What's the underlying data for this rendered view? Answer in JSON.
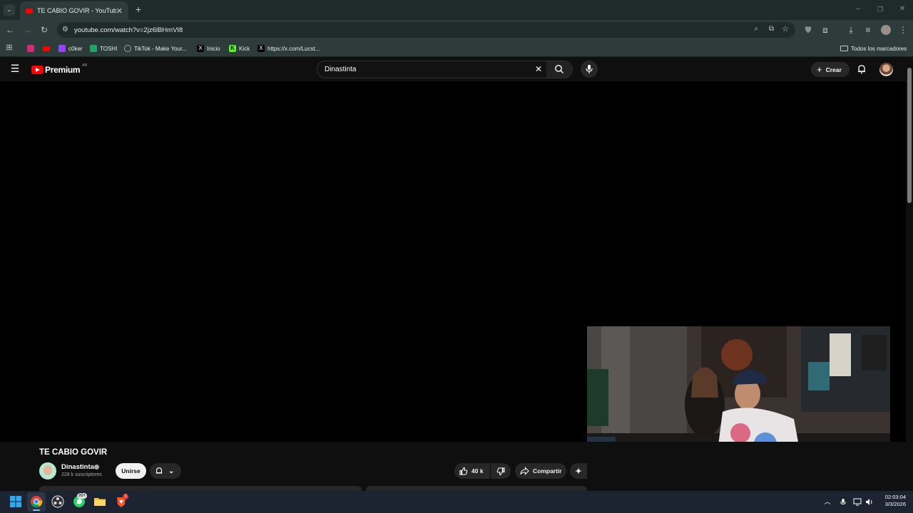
{
  "browser": {
    "tab_title": "TE CABIO GOVIR - YouTube",
    "url": "youtube.com/watch?v=2jz6lBHmVI8",
    "bookmarks": [
      {
        "label": "",
        "icon": "instagram-icon",
        "color": "#d62976"
      },
      {
        "label": "",
        "icon": "youtube-icon",
        "color": "#ff0000"
      },
      {
        "label": "c0ker",
        "icon": "twitch-icon",
        "color": "#9146ff"
      },
      {
        "label": "TOSHI",
        "icon": "sheets-icon",
        "color": "#1fa463"
      },
      {
        "label": "TikTok - Make Your...",
        "icon": "globe-icon",
        "color": "#9aa0a6"
      },
      {
        "label": "Inicio",
        "icon": "x-icon",
        "color": "#000000"
      },
      {
        "label": "Kick",
        "icon": "kick-icon",
        "color": "#53fc18"
      },
      {
        "label": "https://x.com/Lucst...",
        "icon": "x-icon",
        "color": "#000000"
      }
    ],
    "all_bookmarks": "Todos los marcadores"
  },
  "youtube": {
    "logo_text": "Premium",
    "logo_badge": "AR",
    "search_value": "Dinastinta",
    "create_label": "Crear",
    "video_title": "TE CABIO GOVIR",
    "channel_name": "Dinastinta",
    "subscribers": "228 k suscriptores",
    "join_label": "Unirse",
    "likes": "40 k",
    "share_label": "Compartir",
    "accent_color": "#ff0000"
  },
  "taskbar": {
    "time": "02:03:04",
    "date": "3/3/2026",
    "whatsapp_badge": "99+",
    "app_badge": "1"
  }
}
